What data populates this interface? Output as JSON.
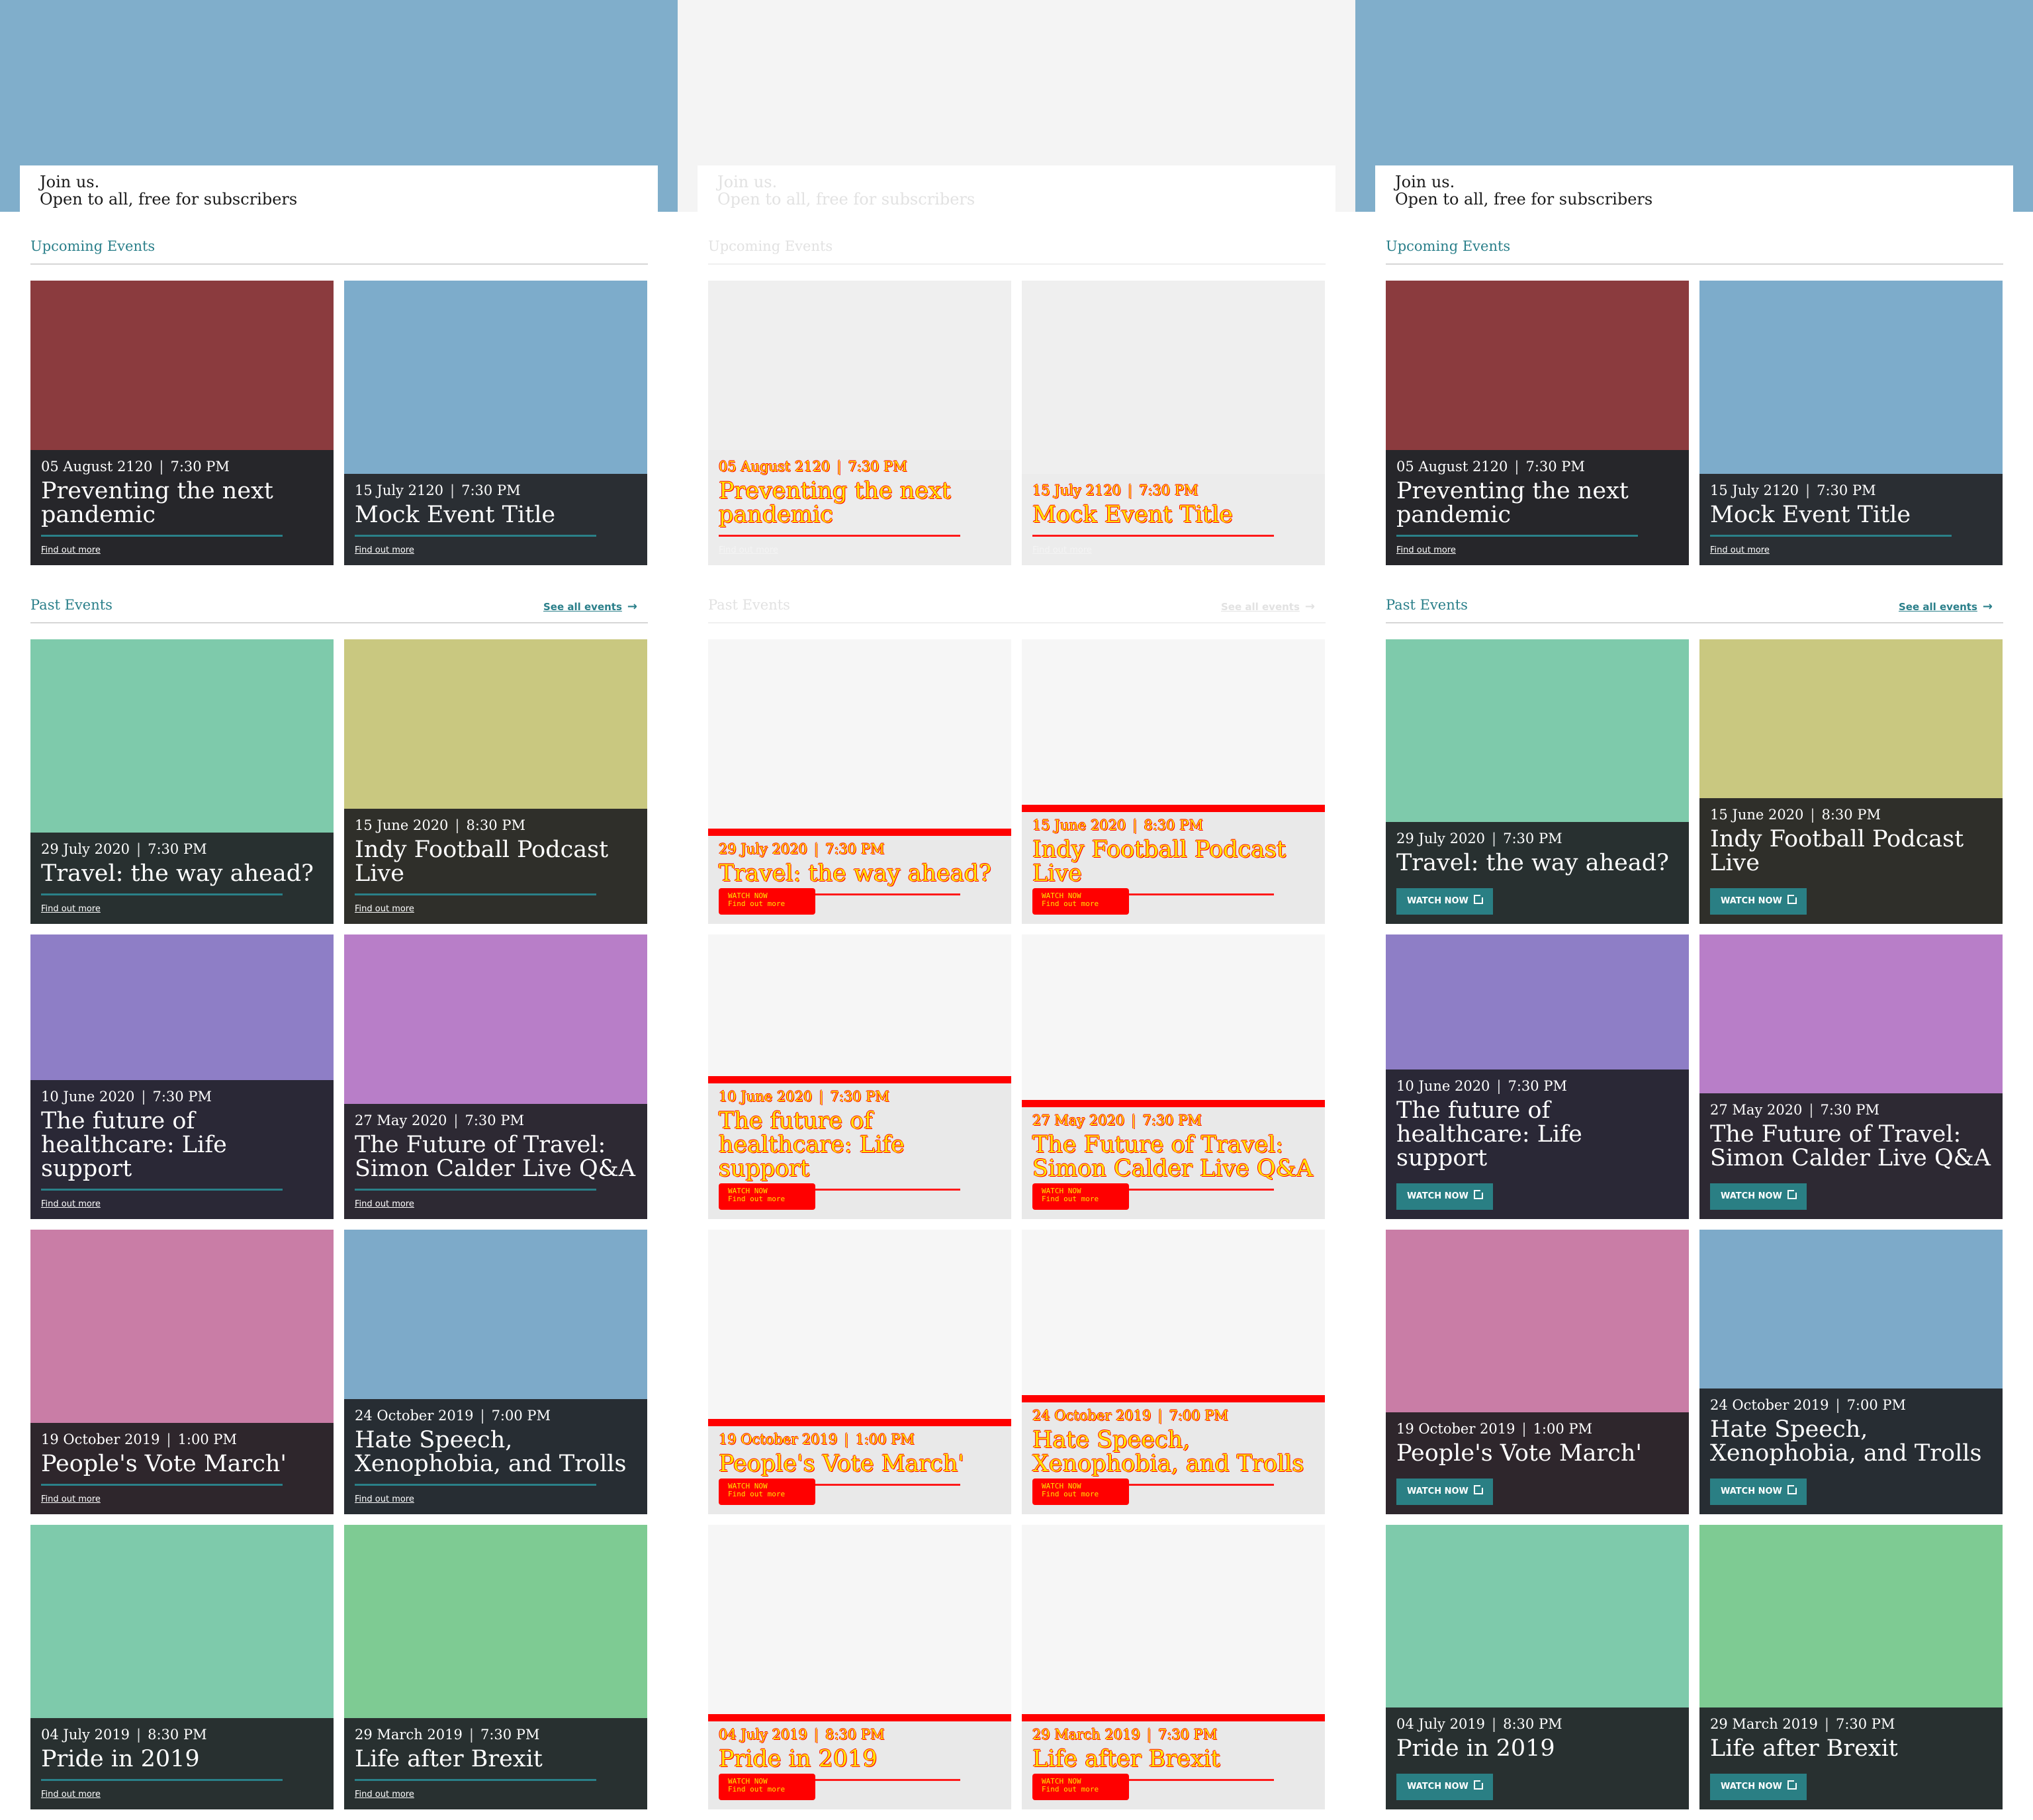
{
  "hero": {
    "line1": "Join us.",
    "line2": "Open to all, free for subscribers"
  },
  "sections": {
    "upcoming": "Upcoming Events",
    "past": "Past Events",
    "see_all": "See all events"
  },
  "link_label": "Find out more",
  "watch_label": "WATCH NOW",
  "colors": {
    "accent": "#2a7f8a",
    "hero_blue": "#80aecb",
    "hero_grey": "#f4f4f4",
    "diff_red": "#ff0000",
    "diff_yellow": "#ffe300"
  },
  "upcoming": [
    {
      "date": "05 August 2120",
      "time": "7:30 PM",
      "title": "Preventing the next pandemic",
      "image_color": "#8b3b3e",
      "panel_color": "#26262a"
    },
    {
      "date": "15 July 2120",
      "time": "7:30 PM",
      "title": "Mock Event Title",
      "image_color": "#7daccb",
      "panel_color": "#2a2e33"
    }
  ],
  "past": [
    {
      "date": "29 July 2020",
      "time": "7:30 PM",
      "title": "Travel: the way ahead?",
      "image_color": "#7ecaab",
      "panel_color": "#283030"
    },
    {
      "date": "15 June 2020",
      "time": "8:30 PM",
      "title": "Indy Football Podcast Live",
      "image_color": "#c9c880",
      "panel_color": "#2f2f2a"
    },
    {
      "date": "10 June 2020",
      "time": "7:30 PM",
      "title": "The future of healthcare: Life support",
      "image_color": "#8e7ec6",
      "panel_color": "#2a2836"
    },
    {
      "date": "27 May 2020",
      "time": "7:30 PM",
      "title": "The Future of Travel: Simon Calder Live Q&A",
      "image_color": "#b87ec8",
      "panel_color": "#2d2933"
    },
    {
      "date": "19 October 2019",
      "time": "1:00 PM",
      "title": "People's Vote March'",
      "image_color": "#c97da6",
      "panel_color": "#2e262c"
    },
    {
      "date": "24 October 2019",
      "time": "7:00 PM",
      "title": "Hate Speech, Xenophobia, and Trolls",
      "image_color": "#7daac9",
      "panel_color": "#272d33"
    },
    {
      "date": "04 July 2019",
      "time": "8:30 PM",
      "title": "Pride in 2019",
      "image_color": "#7ecaab",
      "panel_color": "#283030"
    },
    {
      "date": "29 March 2019",
      "time": "7:30 PM",
      "title": "Life after Brexit",
      "image_color": "#7ecb93",
      "panel_color": "#283030"
    }
  ]
}
